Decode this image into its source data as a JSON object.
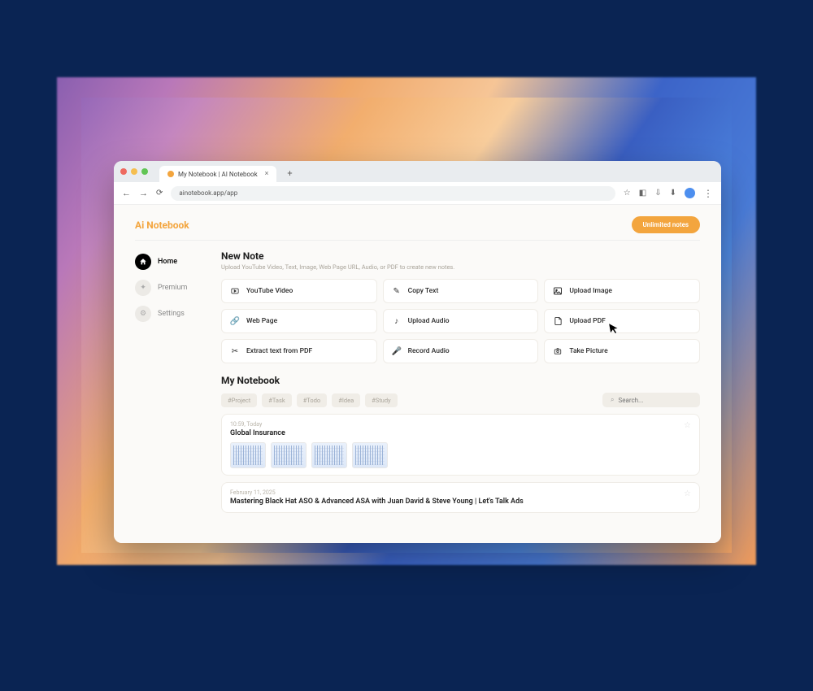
{
  "browser": {
    "tab_title": "My Notebook | AI Notebook",
    "url": "ainotebook.app/app"
  },
  "app": {
    "brand": "Ai Notebook",
    "cta_button": "Unlimited notes"
  },
  "sidebar": {
    "items": [
      {
        "label": "Home",
        "icon": "home",
        "active": true
      },
      {
        "label": "Premium",
        "icon": "sparkle",
        "active": false
      },
      {
        "label": "Settings",
        "icon": "gear",
        "active": false
      }
    ]
  },
  "new_note": {
    "title": "New Note",
    "subtitle": "Upload YouTube Video, Text, Image, Web Page URL, Audio, or PDF to create new notes.",
    "cards": [
      {
        "label": "YouTube Video",
        "icon": "youtube"
      },
      {
        "label": "Copy Text",
        "icon": "pencil"
      },
      {
        "label": "Upload Image",
        "icon": "image"
      },
      {
        "label": "Web Page",
        "icon": "link"
      },
      {
        "label": "Upload Audio",
        "icon": "audio"
      },
      {
        "label": "Upload PDF",
        "icon": "pdf"
      },
      {
        "label": "Extract text from PDF",
        "icon": "extract"
      },
      {
        "label": "Record Audio",
        "icon": "mic"
      },
      {
        "label": "Take Picture",
        "icon": "camera"
      }
    ]
  },
  "my_notebook": {
    "title": "My Notebook",
    "tags": [
      "#Project",
      "#Task",
      "#Todo",
      "#Idea",
      "#Study"
    ],
    "search_placeholder": "Search...",
    "entries": [
      {
        "timestamp": "10:59, Today",
        "title": "Global Insurance",
        "thumbs": 4
      },
      {
        "timestamp": "February 11, 2025",
        "title": "Mastering Black Hat ASO & Advanced ASA with Juan David & Steve Young | Let's Talk Ads",
        "thumbs": 0
      }
    ]
  },
  "colors": {
    "accent": "#f3a53e",
    "page_bg": "#0a2453"
  }
}
